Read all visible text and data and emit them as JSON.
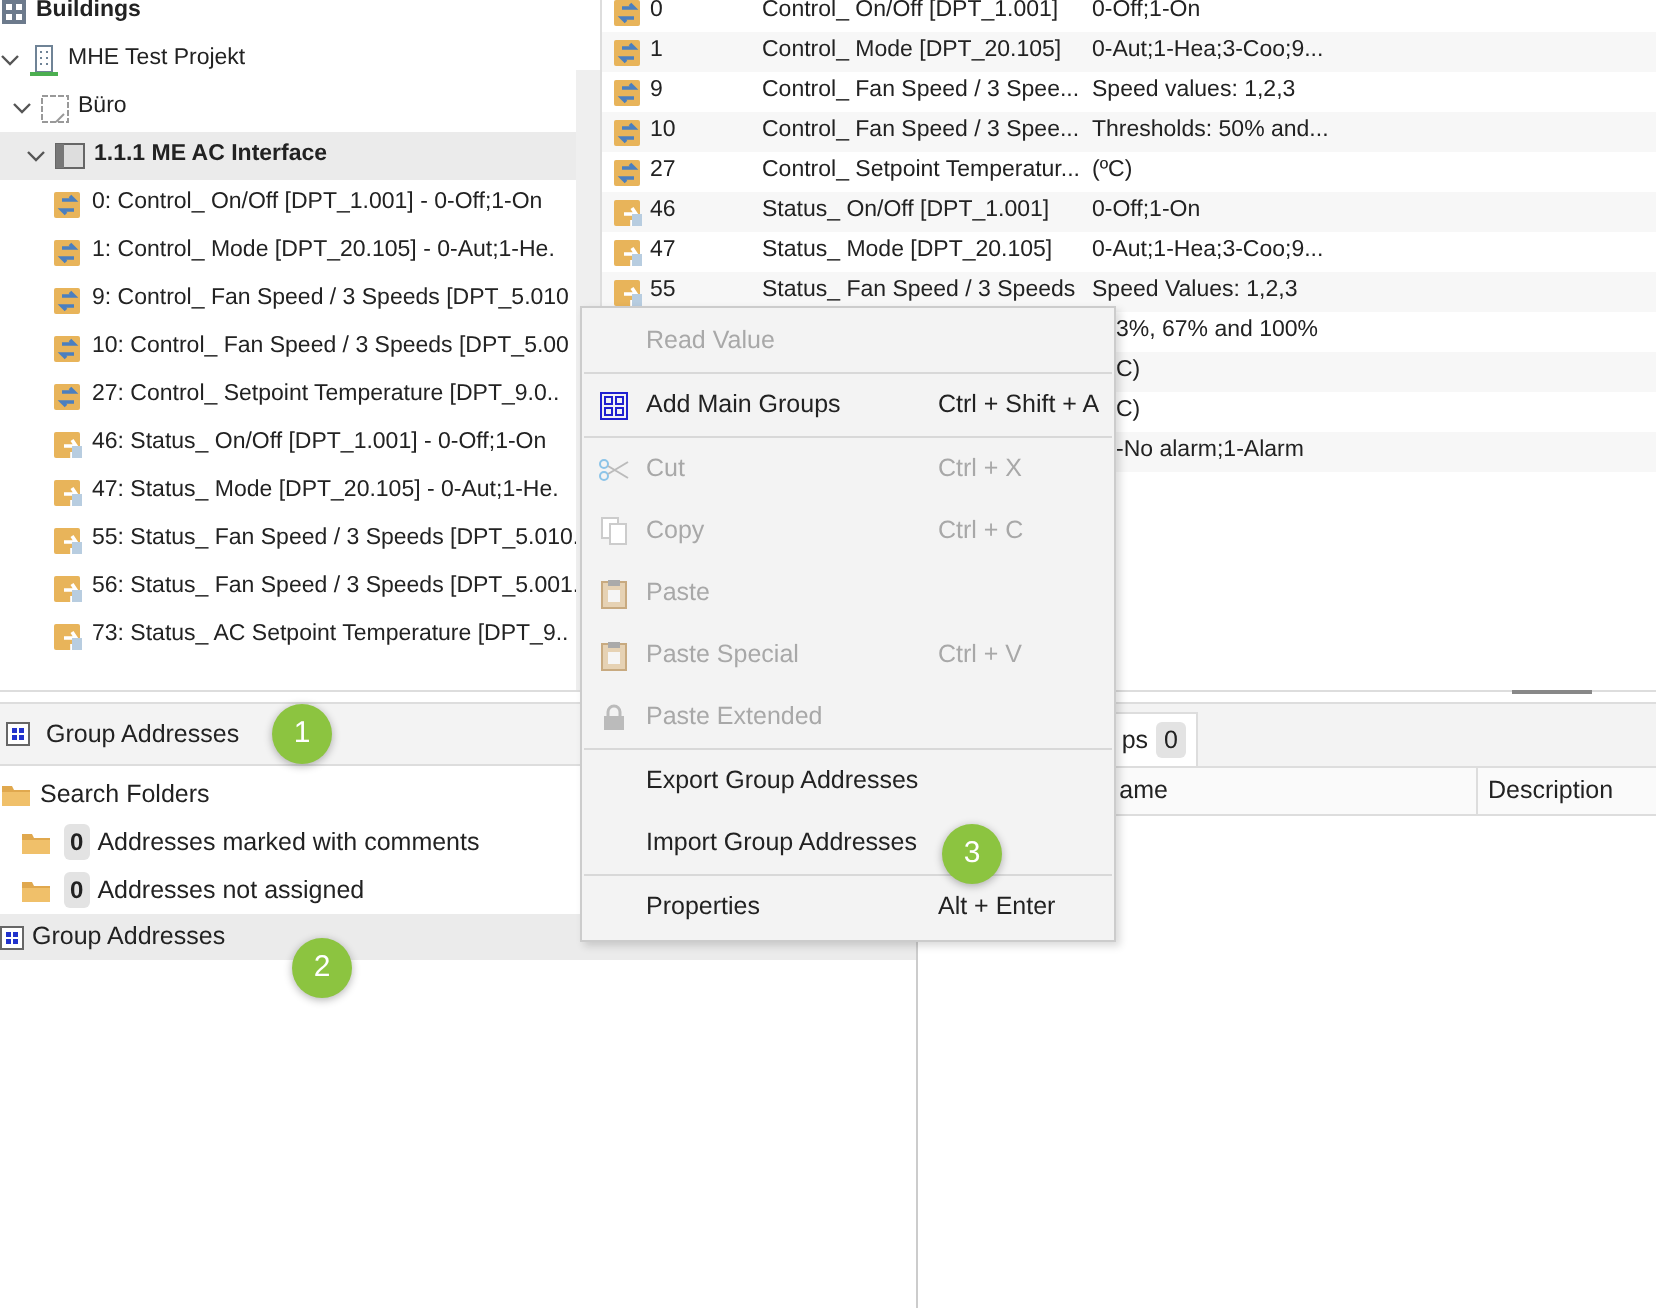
{
  "buildings_tree": {
    "label": "Buildings",
    "kind": "root",
    "children": [
      {
        "label": "MHE Test Projekt",
        "kind": "project",
        "expanded": true,
        "selected": false,
        "children": [
          {
            "label": "Büro",
            "kind": "room",
            "expanded": true,
            "selected": false,
            "children": [
              {
                "label": "1.1.1 ME AC Interface",
                "kind": "device",
                "expanded": true,
                "selected": true,
                "children": [
                  {
                    "label": "0: Control_ On/Off [DPT_1.001] - 0-Off;1-On",
                    "kind": "control",
                    "selected": false
                  },
                  {
                    "label": "1: Control_ Mode [DPT_20.105] - 0-Aut;1-He.",
                    "kind": "control",
                    "selected": false
                  },
                  {
                    "label": "9: Control_ Fan Speed / 3 Speeds [DPT_5.010",
                    "kind": "control",
                    "selected": false
                  },
                  {
                    "label": "10: Control_ Fan Speed / 3 Speeds [DPT_5.00",
                    "kind": "control",
                    "selected": false
                  },
                  {
                    "label": "27: Control_ Setpoint Temperature [DPT_9.0..",
                    "kind": "control",
                    "selected": false
                  },
                  {
                    "label": "46: Status_ On/Off [DPT_1.001] - 0-Off;1-On",
                    "kind": "status",
                    "selected": false
                  },
                  {
                    "label": "47: Status_ Mode [DPT_20.105] - 0-Aut;1-He.",
                    "kind": "status",
                    "selected": false
                  },
                  {
                    "label": "55: Status_ Fan Speed / 3 Speeds [DPT_5.010.",
                    "kind": "status",
                    "selected": false
                  },
                  {
                    "label": "56: Status_ Fan Speed / 3 Speeds [DPT_5.001.",
                    "kind": "status",
                    "selected": false
                  },
                  {
                    "label": "73: Status_ AC Setpoint Temperature [DPT_9..",
                    "kind": "status",
                    "selected": false
                  }
                ]
              }
            ]
          }
        ]
      }
    ]
  },
  "objects_table": {
    "rows": [
      {
        "kind": "control",
        "number": "0",
        "name": "Control_ On/Off [DPT_1.001]",
        "description": "0-Off;1-On"
      },
      {
        "kind": "control",
        "number": "1",
        "name": "Control_ Mode [DPT_20.105]",
        "description": "0-Aut;1-Hea;3-Coo;9..."
      },
      {
        "kind": "control",
        "number": "9",
        "name": "Control_ Fan Speed / 3 Spee...",
        "description": "Speed values: 1,2,3"
      },
      {
        "kind": "control",
        "number": "10",
        "name": "Control_ Fan Speed / 3 Spee...",
        "description": "Thresholds: 50% and..."
      },
      {
        "kind": "control",
        "number": "27",
        "name": "Control_ Setpoint Temperatur...",
        "description": "(ºC)"
      },
      {
        "kind": "status",
        "number": "46",
        "name": "Status_ On/Off [DPT_1.001]",
        "description": "0-Off;1-On"
      },
      {
        "kind": "status",
        "number": "47",
        "name": "Status_ Mode [DPT_20.105]",
        "description": "0-Aut;1-Hea;3-Coo;9..."
      },
      {
        "kind": "status",
        "number": "55",
        "name": "Status_ Fan Speed / 3 Speeds",
        "description": "Speed Values: 1,2,3"
      },
      {
        "kind": "covered",
        "description": "3%, 67% and 100%"
      },
      {
        "kind": "covered",
        "description": "C)"
      },
      {
        "kind": "covered",
        "description": "C)"
      },
      {
        "kind": "covered",
        "description": "-No alarm;1-Alarm"
      }
    ]
  },
  "group_addresses_panel": {
    "title": "Group Addresses",
    "badge": "1",
    "items": [
      {
        "label": "Search Folders",
        "kind": "folder-root",
        "selected": false
      },
      {
        "label": "Addresses marked with comments",
        "count": "0",
        "kind": "folder",
        "selected": false
      },
      {
        "label": "Addresses not assigned",
        "count": "0",
        "kind": "folder",
        "selected": false
      },
      {
        "label": "Group Addresses",
        "kind": "groups",
        "selected": true,
        "badge": "2"
      }
    ]
  },
  "details_panel": {
    "tab": {
      "label": "ps",
      "count": "0",
      "selected": true
    },
    "columns": [
      "ame",
      "Description"
    ]
  },
  "context_menu": {
    "items": [
      {
        "kind": "read",
        "label": "Read Value",
        "disabled": true
      },
      {
        "kind": "separator"
      },
      {
        "kind": "add",
        "label": "Add Main Groups",
        "shortcut": "Ctrl + Shift + A",
        "disabled": false
      },
      {
        "kind": "separator"
      },
      {
        "kind": "cut",
        "label": "Cut",
        "shortcut": "Ctrl + X",
        "disabled": true
      },
      {
        "kind": "copy",
        "label": "Copy",
        "shortcut": "Ctrl + C",
        "disabled": true
      },
      {
        "kind": "paste",
        "label": "Paste",
        "disabled": true
      },
      {
        "kind": "paste",
        "label": "Paste Special",
        "shortcut": "Ctrl + V",
        "disabled": true
      },
      {
        "kind": "extended",
        "label": "Paste Extended",
        "disabled": true
      },
      {
        "kind": "separator"
      },
      {
        "kind": "export",
        "label": "Export Group Addresses",
        "disabled": false
      },
      {
        "kind": "import",
        "label": "Import Group Addresses",
        "disabled": false,
        "badge": "3"
      },
      {
        "kind": "separator"
      },
      {
        "kind": "properties",
        "label": "Properties",
        "shortcut": "Alt + Enter",
        "disabled": false
      }
    ]
  }
}
